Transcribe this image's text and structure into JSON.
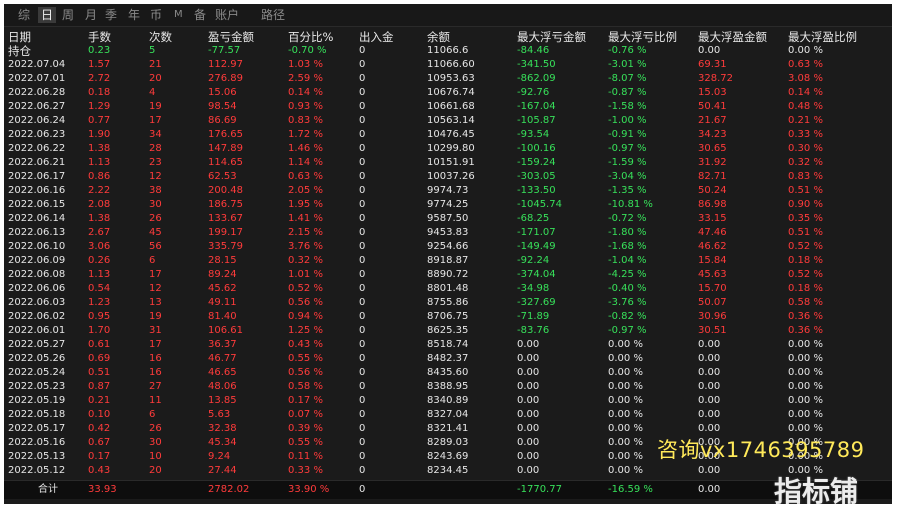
{
  "tabs": [
    "综",
    "日",
    "周",
    "月",
    "季",
    "年",
    "币",
    "M",
    "备",
    "账户",
    "路径"
  ],
  "active_tab": "日",
  "headers": [
    "日期",
    "手数",
    "次数",
    "盈亏金额",
    "百分比%",
    "出入金",
    "余额",
    "最大浮亏金额",
    "最大浮亏比例",
    "最大浮盈金额",
    "最大浮盈比例"
  ],
  "holding": [
    "持仓",
    "0.23",
    "5",
    "-77.57",
    "-0.70 %",
    "0",
    "11066.6",
    "-84.46",
    "-0.76 %",
    "0.00",
    "0.00 %"
  ],
  "rows": [
    [
      "2022.07.04",
      "1.57",
      "21",
      "112.97",
      "1.03 %",
      "0",
      "11066.60",
      "-341.50",
      "-3.01 %",
      "69.31",
      "0.63 %"
    ],
    [
      "2022.07.01",
      "2.72",
      "20",
      "276.89",
      "2.59 %",
      "0",
      "10953.63",
      "-862.09",
      "-8.07 %",
      "328.72",
      "3.08 %"
    ],
    [
      "2022.06.28",
      "0.18",
      "4",
      "15.06",
      "0.14 %",
      "0",
      "10676.74",
      "-92.76",
      "-0.87 %",
      "15.03",
      "0.14 %"
    ],
    [
      "2022.06.27",
      "1.29",
      "19",
      "98.54",
      "0.93 %",
      "0",
      "10661.68",
      "-167.04",
      "-1.58 %",
      "50.41",
      "0.48 %"
    ],
    [
      "2022.06.24",
      "0.77",
      "17",
      "86.69",
      "0.83 %",
      "0",
      "10563.14",
      "-105.87",
      "-1.00 %",
      "21.67",
      "0.21 %"
    ],
    [
      "2022.06.23",
      "1.90",
      "34",
      "176.65",
      "1.72 %",
      "0",
      "10476.45",
      "-93.54",
      "-0.91 %",
      "34.23",
      "0.33 %"
    ],
    [
      "2022.06.22",
      "1.38",
      "28",
      "147.89",
      "1.46 %",
      "0",
      "10299.80",
      "-100.16",
      "-0.97 %",
      "30.65",
      "0.30 %"
    ],
    [
      "2022.06.21",
      "1.13",
      "23",
      "114.65",
      "1.14 %",
      "0",
      "10151.91",
      "-159.24",
      "-1.59 %",
      "31.92",
      "0.32 %"
    ],
    [
      "2022.06.17",
      "0.86",
      "12",
      "62.53",
      "0.63 %",
      "0",
      "10037.26",
      "-303.05",
      "-3.04 %",
      "82.71",
      "0.83 %"
    ],
    [
      "2022.06.16",
      "2.22",
      "38",
      "200.48",
      "2.05 %",
      "0",
      "9974.73",
      "-133.50",
      "-1.35 %",
      "50.24",
      "0.51 %"
    ],
    [
      "2022.06.15",
      "2.08",
      "30",
      "186.75",
      "1.95 %",
      "0",
      "9774.25",
      "-1045.74",
      "-10.81 %",
      "86.98",
      "0.90 %"
    ],
    [
      "2022.06.14",
      "1.38",
      "26",
      "133.67",
      "1.41 %",
      "0",
      "9587.50",
      "-68.25",
      "-0.72 %",
      "33.15",
      "0.35 %"
    ],
    [
      "2022.06.13",
      "2.67",
      "45",
      "199.17",
      "2.15 %",
      "0",
      "9453.83",
      "-171.07",
      "-1.80 %",
      "47.46",
      "0.51 %"
    ],
    [
      "2022.06.10",
      "3.06",
      "56",
      "335.79",
      "3.76 %",
      "0",
      "9254.66",
      "-149.49",
      "-1.68 %",
      "46.62",
      "0.52 %"
    ],
    [
      "2022.06.09",
      "0.26",
      "6",
      "28.15",
      "0.32 %",
      "0",
      "8918.87",
      "-92.24",
      "-1.04 %",
      "15.84",
      "0.18 %"
    ],
    [
      "2022.06.08",
      "1.13",
      "17",
      "89.24",
      "1.01 %",
      "0",
      "8890.72",
      "-374.04",
      "-4.25 %",
      "45.63",
      "0.52 %"
    ],
    [
      "2022.06.06",
      "0.54",
      "12",
      "45.62",
      "0.52 %",
      "0",
      "8801.48",
      "-34.98",
      "-0.40 %",
      "15.70",
      "0.18 %"
    ],
    [
      "2022.06.03",
      "1.23",
      "13",
      "49.11",
      "0.56 %",
      "0",
      "8755.86",
      "-327.69",
      "-3.76 %",
      "50.07",
      "0.58 %"
    ],
    [
      "2022.06.02",
      "0.95",
      "19",
      "81.40",
      "0.94 %",
      "0",
      "8706.75",
      "-71.89",
      "-0.82 %",
      "30.96",
      "0.36 %"
    ],
    [
      "2022.06.01",
      "1.70",
      "31",
      "106.61",
      "1.25 %",
      "0",
      "8625.35",
      "-83.76",
      "-0.97 %",
      "30.51",
      "0.36 %"
    ],
    [
      "2022.05.27",
      "0.61",
      "17",
      "36.37",
      "0.43 %",
      "0",
      "8518.74",
      "0.00",
      "0.00 %",
      "0.00",
      "0.00 %"
    ],
    [
      "2022.05.26",
      "0.69",
      "16",
      "46.77",
      "0.55 %",
      "0",
      "8482.37",
      "0.00",
      "0.00 %",
      "0.00",
      "0.00 %"
    ],
    [
      "2022.05.24",
      "0.51",
      "16",
      "46.65",
      "0.56 %",
      "0",
      "8435.60",
      "0.00",
      "0.00 %",
      "0.00",
      "0.00 %"
    ],
    [
      "2022.05.23",
      "0.87",
      "27",
      "48.06",
      "0.58 %",
      "0",
      "8388.95",
      "0.00",
      "0.00 %",
      "0.00",
      "0.00 %"
    ],
    [
      "2022.05.19",
      "0.21",
      "11",
      "13.85",
      "0.17 %",
      "0",
      "8340.89",
      "0.00",
      "0.00 %",
      "0.00",
      "0.00 %"
    ],
    [
      "2022.05.18",
      "0.10",
      "6",
      "5.63",
      "0.07 %",
      "0",
      "8327.04",
      "0.00",
      "0.00 %",
      "0.00",
      "0.00 %"
    ],
    [
      "2022.05.17",
      "0.42",
      "26",
      "32.38",
      "0.39 %",
      "0",
      "8321.41",
      "0.00",
      "0.00 %",
      "0.00",
      "0.00 %"
    ],
    [
      "2022.05.16",
      "0.67",
      "30",
      "45.34",
      "0.55 %",
      "0",
      "8289.03",
      "0.00",
      "0.00 %",
      "0.00",
      "0.00 %"
    ],
    [
      "2022.05.13",
      "0.17",
      "10",
      "9.24",
      "0.11 %",
      "0",
      "8243.69",
      "0.00",
      "0.00 %",
      "0.00",
      "0.00 %"
    ],
    [
      "2022.05.12",
      "0.43",
      "20",
      "27.44",
      "0.33 %",
      "0",
      "8234.45",
      "0.00",
      "0.00 %",
      "0.00",
      "0.00 %"
    ]
  ],
  "total": [
    "合计",
    "33.93",
    "",
    "2782.02",
    "33.90 %",
    "0",
    "",
    "-1770.77",
    "-16.59 %",
    "0.00",
    ""
  ],
  "watermark_text": "咨询vx1746395789",
  "logo_text": "指标铺",
  "colors": {
    "positive": "#ff3b3b",
    "negative": "#37e05a",
    "neutral": "#e6e6e6",
    "background": "#1b1b1b",
    "watermark": "#ffe95a"
  }
}
